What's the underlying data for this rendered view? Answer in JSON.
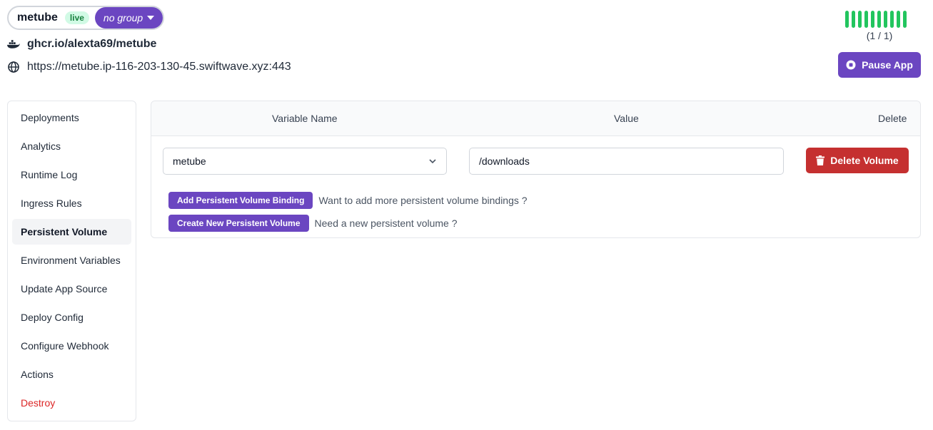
{
  "header": {
    "app_name": "metube",
    "status_badge": "live",
    "group_label": "no group",
    "docker_image": "ghcr.io/alexta69/metube",
    "url": "https://metube.ip-116-203-130-45.swiftwave.xyz:443",
    "replica_count": "(1 / 1)",
    "pause_label": "Pause App"
  },
  "sidebar": {
    "items": [
      {
        "label": "Deployments"
      },
      {
        "label": "Analytics"
      },
      {
        "label": "Runtime Log"
      },
      {
        "label": "Ingress Rules"
      },
      {
        "label": "Persistent Volume"
      },
      {
        "label": "Environment Variables"
      },
      {
        "label": "Update App Source"
      },
      {
        "label": "Deploy Config"
      },
      {
        "label": "Configure Webhook"
      },
      {
        "label": "Actions"
      },
      {
        "label": "Destroy"
      }
    ],
    "active": "Persistent Volume"
  },
  "table": {
    "columns": [
      "Variable Name",
      "Value",
      "Delete"
    ],
    "row": {
      "volume": "metube",
      "mount_path": "/downloads",
      "delete_label": "Delete Volume"
    }
  },
  "actions": {
    "add_binding_label": "Add Persistent Volume Binding",
    "add_binding_hint": "Want to add more persistent volume bindings ?",
    "create_volume_label": "Create New Persistent Volume",
    "create_volume_hint": "Need a new persistent volume ?"
  },
  "colors": {
    "primary": "#6b46c1",
    "danger": "#c53030",
    "success": "#22c55e"
  }
}
